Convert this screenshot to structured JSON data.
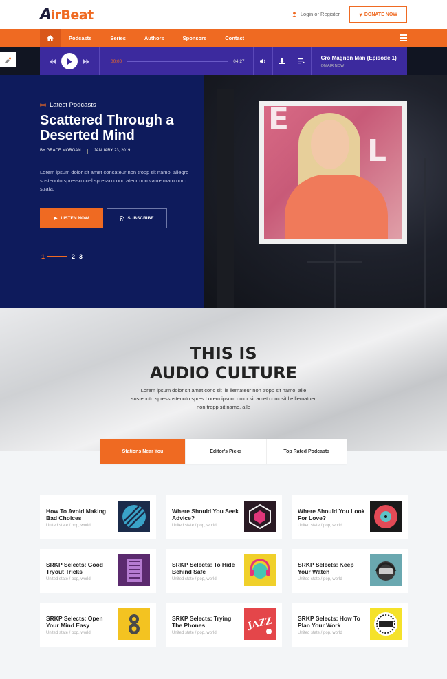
{
  "brand": {
    "logo_a": "A",
    "logo_rest": "irBeat"
  },
  "header": {
    "login_label": "Login or Register",
    "donate_label": "DONATE NOW"
  },
  "nav": {
    "items": [
      "Podcasts",
      "Series",
      "Authors",
      "Sponsors",
      "Contact"
    ]
  },
  "player": {
    "current_time": "00:00",
    "duration": "04:27",
    "now_playing_title": "Cro Magnon Man (Episode 1)",
    "now_playing_status": "ON AIR NOW"
  },
  "hero": {
    "kicker": "Latest Podcasts",
    "title": "Scattered Through a Deserted Mind",
    "author": "BY GRACE MORGAN",
    "date": "JANUARY 23, 2019",
    "text": "Lorem ipsum dolor sit amet concateur non tropp sit namo, allegro sustenuto spresso coel spresso conc ateur non value maro noro strata.",
    "listen_label": "LISTEN NOW",
    "subscribe_label": "SUBSCRIBE",
    "pages": [
      "1",
      "2",
      "3"
    ]
  },
  "culture": {
    "title_line1": "THIS IS",
    "title_line2": "AUDIO CULTURE",
    "text": "Lorem ipsum dolor sit amet conc sit lle liemateur non tropp sit namo, alle sustenuto spressustenuto spres Lorem ipsum dolor sit amet conc sit lle liematuer non tropp sit namo, alle"
  },
  "tabs": [
    "Stations Near You",
    "Editor's Picks",
    "Top Rated Podcasts"
  ],
  "cards": [
    {
      "title": "How To Avoid Making Bad Choices",
      "sub": "United state / pop, world",
      "thumb_color": "#1b2b4a",
      "thumb_icon": "circle-stripes-icon"
    },
    {
      "title": "Where Should You Seek Advice?",
      "sub": "United state / pop, world",
      "thumb_color": "#2a1a24",
      "thumb_icon": "cube-icon"
    },
    {
      "title": "Where Should You Look For Love?",
      "sub": "United state / pop, world",
      "thumb_color": "#1a1a1a",
      "thumb_icon": "record-icon"
    },
    {
      "title": "SRKP Selects: Good Tryout Tricks",
      "sub": "United state / pop, world",
      "thumb_color": "#5b2a6e",
      "thumb_icon": "building-icon"
    },
    {
      "title": "SRKP Selects: To Hide Behind Safe",
      "sub": "United state / pop, world",
      "thumb_color": "#f0d02a",
      "thumb_icon": "headphones-icon"
    },
    {
      "title": "SRKP Selects: Keep Your Watch",
      "sub": "United state / pop, world",
      "thumb_color": "#6aa8b0",
      "thumb_icon": "helmet-icon"
    },
    {
      "title": "SRKP Selects: Open Your Mind Easy",
      "sub": "United state / pop, world",
      "thumb_color": "#f3c321",
      "thumb_icon": "number-icon"
    },
    {
      "title": "SRKP Selects: Trying The Phones",
      "sub": "United state / pop, world",
      "thumb_color": "#e4464a",
      "thumb_icon": "jazz-icon"
    },
    {
      "title": "SRKP Selects: How To Plan Your Work",
      "sub": "United state / pop, world",
      "thumb_color": "#f5e22a",
      "thumb_icon": "badge-icon"
    }
  ],
  "colors": {
    "accent": "#ef6a22",
    "navy": "#0e1b5c",
    "player": "#3c2a9e"
  }
}
